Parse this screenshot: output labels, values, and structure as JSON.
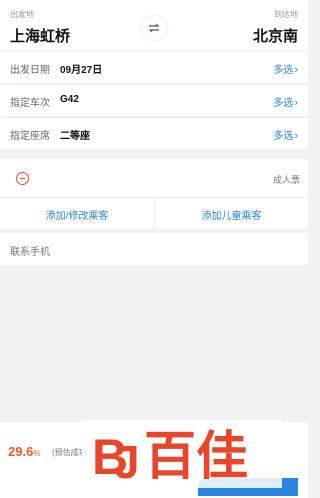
{
  "route": {
    "from_label": "出发地",
    "from_station": "上海虹桥",
    "to_label": "到达地",
    "to_station": "北京南"
  },
  "options": [
    {
      "label": "出发日期",
      "value": "09月27日",
      "more": "多选"
    },
    {
      "label": "指定车次",
      "value": "G42",
      "more": "多选"
    },
    {
      "label": "指定座席",
      "value": "二等座",
      "more": "多选"
    }
  ],
  "passenger": {
    "ticket_type": "成人票",
    "add_passenger": "添加/修改乘客",
    "add_child": "添加儿童乘客"
  },
  "contact": {
    "label": "联系手机"
  },
  "footer": {
    "success_rate": "29.6",
    "success_rate_unit": "%",
    "success_note": "(预估成功"
  },
  "watermark": {
    "text": "BJ百佳"
  },
  "colors": {
    "accent": "#2b86e0",
    "rate": "#f05a28",
    "remove": "#e74c3c",
    "watermark": "#e8462b"
  }
}
